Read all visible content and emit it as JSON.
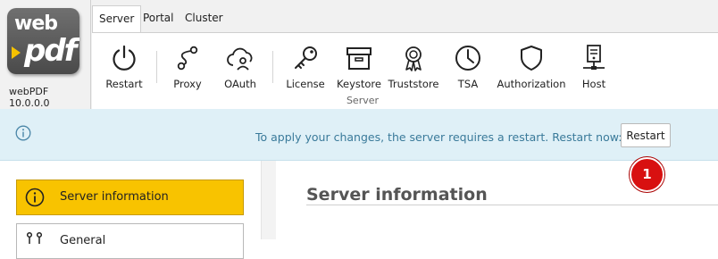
{
  "app": {
    "logo_text_top": "web",
    "logo_text_bottom": "pdf",
    "version": "webPDF 10.0.0.0"
  },
  "tabs": [
    {
      "label": "Server",
      "active": true
    },
    {
      "label": "Portal",
      "active": false
    },
    {
      "label": "Cluster",
      "active": false
    }
  ],
  "ribbon": {
    "group_label": "Server",
    "buttons": [
      {
        "label": "Restart",
        "icon": "power-icon"
      },
      {
        "label": "Proxy",
        "icon": "proxy-icon"
      },
      {
        "label": "OAuth",
        "icon": "cloud-user-icon"
      },
      {
        "label": "License",
        "icon": "key-icon"
      },
      {
        "label": "Keystore",
        "icon": "archive-box-icon"
      },
      {
        "label": "Truststore",
        "icon": "award-ribbon-icon"
      },
      {
        "label": "TSA",
        "icon": "clock-icon"
      },
      {
        "label": "Authorization",
        "icon": "shield-icon"
      },
      {
        "label": "Host",
        "icon": "server-host-icon"
      }
    ]
  },
  "infobar": {
    "message": "To apply your changes, the server requires a restart. Restart now:",
    "button_label": "Restart",
    "badge": "1"
  },
  "nav": {
    "items": [
      {
        "label": "Server information",
        "icon": "info-circle-icon",
        "active": true
      },
      {
        "label": "General",
        "icon": "connection-icon",
        "active": false
      }
    ]
  },
  "content": {
    "title": "Server information"
  },
  "colors": {
    "accent": "#f8c300",
    "infobar_bg": "#dff0f7",
    "infobar_text": "#3a7a9a",
    "badge": "#d81010"
  }
}
